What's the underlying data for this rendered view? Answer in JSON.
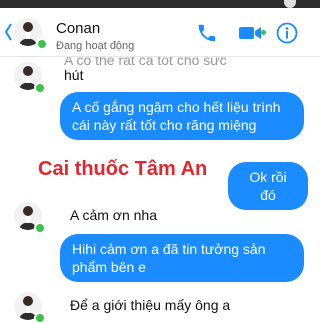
{
  "header": {
    "name": "Conan",
    "status": "Đang hoạt động",
    "icons": [
      "back-icon",
      "phone-icon",
      "video-icon",
      "info-icon"
    ],
    "accent": "#1a8cff"
  },
  "messages": [
    {
      "side": "left",
      "text": "hút",
      "cut_line": "A  có  thể  rất  cả  tốt  cho  sức  khoẻ"
    },
    {
      "side": "right",
      "text": "A cố gắng ngậm cho hết liệu trình cái này rất tốt cho răng miệng"
    },
    {
      "side": "right",
      "text": "Ok rồi đó"
    },
    {
      "side": "left",
      "text": "A cảm ơn nha"
    },
    {
      "side": "right",
      "text": "Hihi cảm ơn a đã tin tưởng sản phẩm bên e"
    },
    {
      "side": "left",
      "text": "Để a giới thiệu mấy ông a"
    }
  ],
  "watermark": "Cai thuốc Tâm An",
  "colors": {
    "online": "#3cc24a",
    "watermark": "#e4252d",
    "bubble": "#1a8cff"
  }
}
